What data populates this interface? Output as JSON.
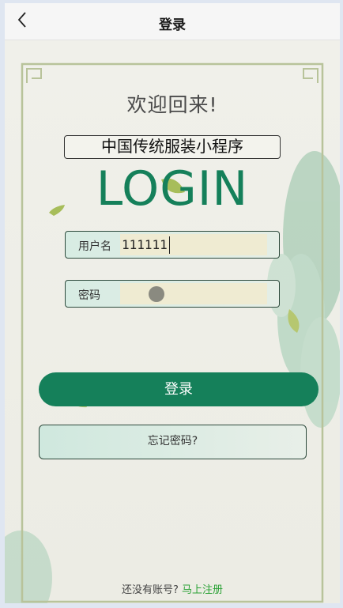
{
  "nav": {
    "title": "登录"
  },
  "welcome_text": "欢迎回来!",
  "app_name": "中国传统服装小程序",
  "brand_word": "LOGIN",
  "form": {
    "username": {
      "label": "用户名",
      "value": "111111"
    },
    "password": {
      "label": "密码",
      "value": ""
    }
  },
  "buttons": {
    "login": "登录",
    "forgot": "忘记密码?"
  },
  "register": {
    "prompt": "还没有账号?",
    "link": "马上注册"
  },
  "colors": {
    "primary": "#15805a",
    "link": "#2aa135"
  }
}
